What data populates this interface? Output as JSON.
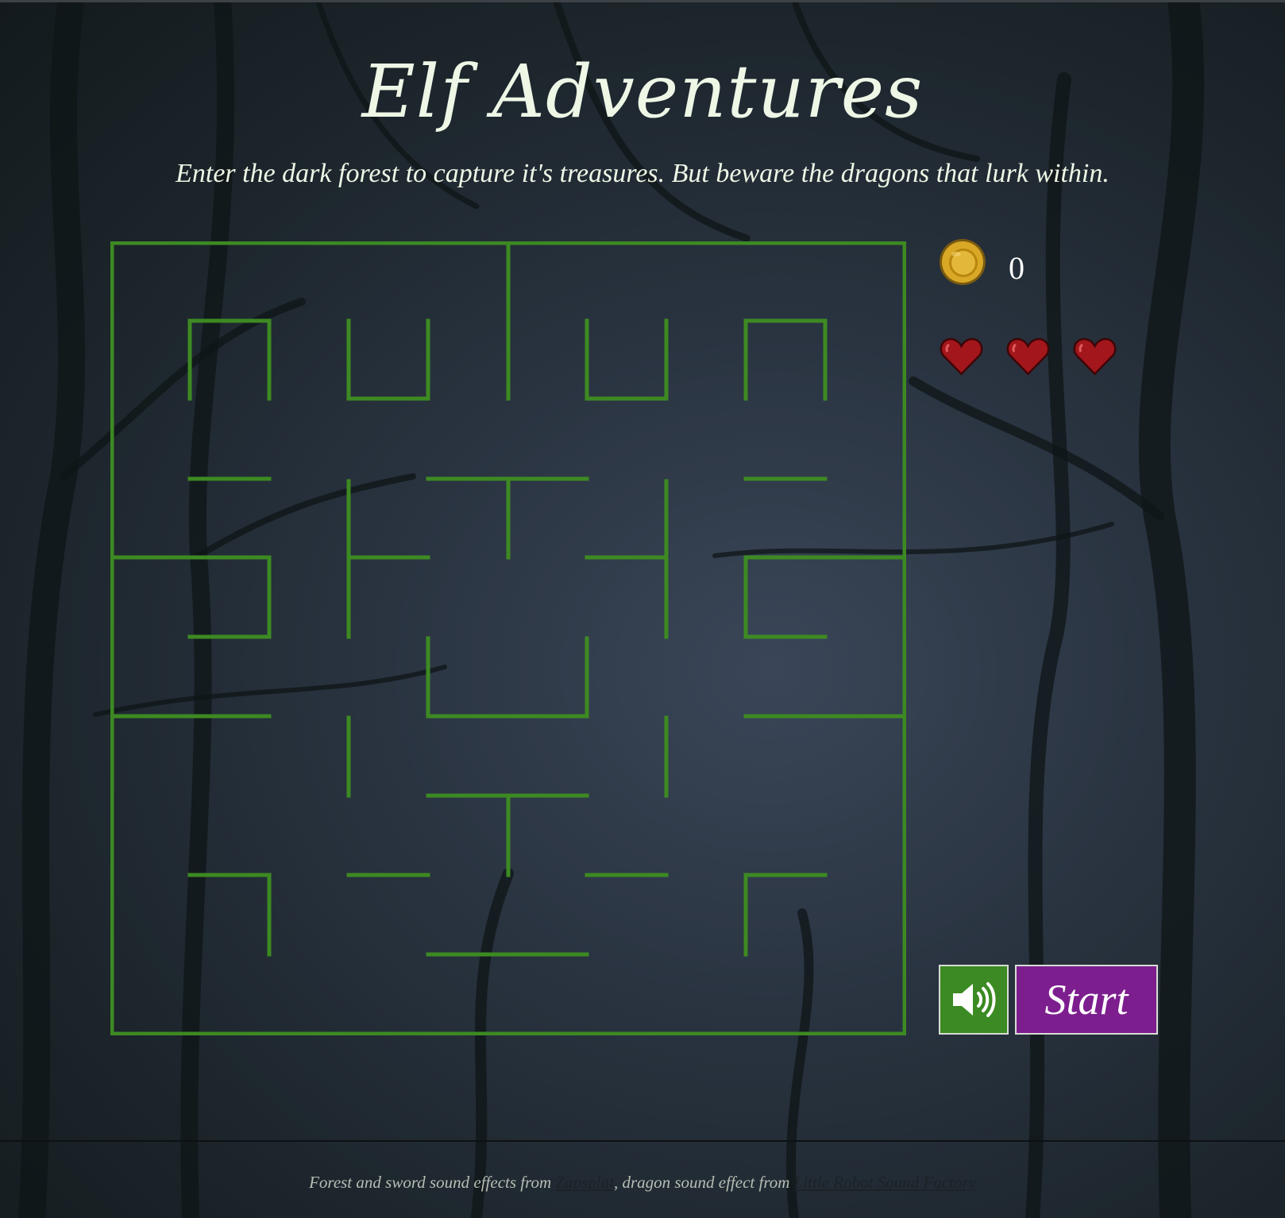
{
  "header": {
    "title": "Elf Adventures",
    "subtitle": "Enter the dark forest to capture it's treasures. But beware the dragons that lurk within."
  },
  "stats": {
    "coins": "0",
    "lives": 3,
    "coin_icon": "coin-icon",
    "heart_icon": "heart-icon"
  },
  "controls": {
    "sound_icon": "speaker-icon",
    "start_label": "Start"
  },
  "footer": {
    "text_before": "Forest and sword sound effects from ",
    "link1": "Zapsplat",
    "text_middle": ", dragon sound effect from ",
    "link2": "Little Robot Sound Factory"
  },
  "colors": {
    "maze_wall": "#3d8a22",
    "start_button": "#7d1e8f",
    "sound_button": "#3b8a23",
    "heart": "#a3161b",
    "coin": "#d9a826"
  }
}
